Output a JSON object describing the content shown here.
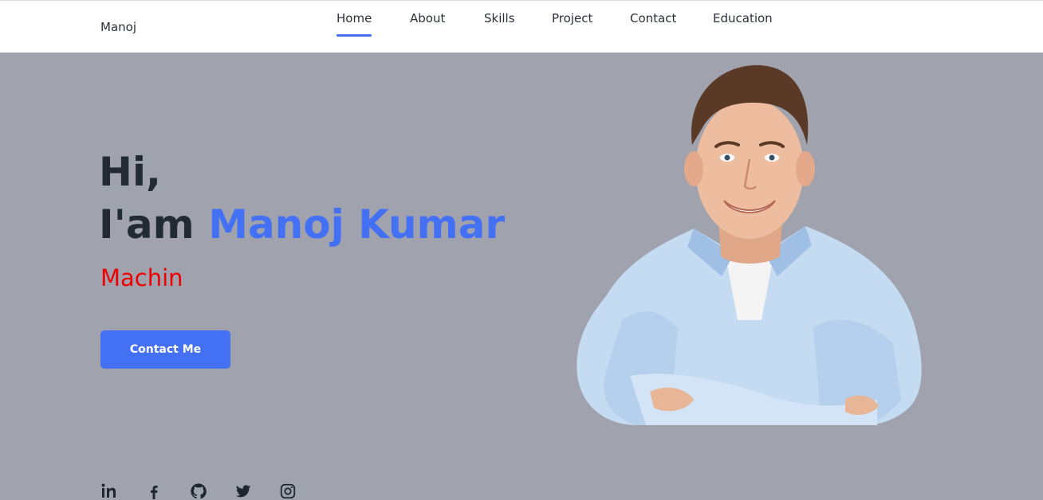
{
  "header": {
    "brand": "Manoj",
    "nav": [
      {
        "label": "Home",
        "active": true
      },
      {
        "label": "About"
      },
      {
        "label": "Skills"
      },
      {
        "label": "Project"
      },
      {
        "label": "Contact"
      },
      {
        "label": "Education"
      }
    ]
  },
  "hero": {
    "greeting_line1": "Hi,",
    "greeting_prefix": "I'am",
    "name": "Manoj Kumar",
    "role": "Machin",
    "cta_label": "Contact Me"
  },
  "social_icons": [
    "linkedin-icon",
    "facebook-icon",
    "github-icon",
    "twitter-icon",
    "instagram-icon"
  ],
  "colors": {
    "accent": "#4470f4",
    "role": "#ee0000",
    "hero_bg": "#a0a3ae",
    "text_dark": "#222a33"
  }
}
